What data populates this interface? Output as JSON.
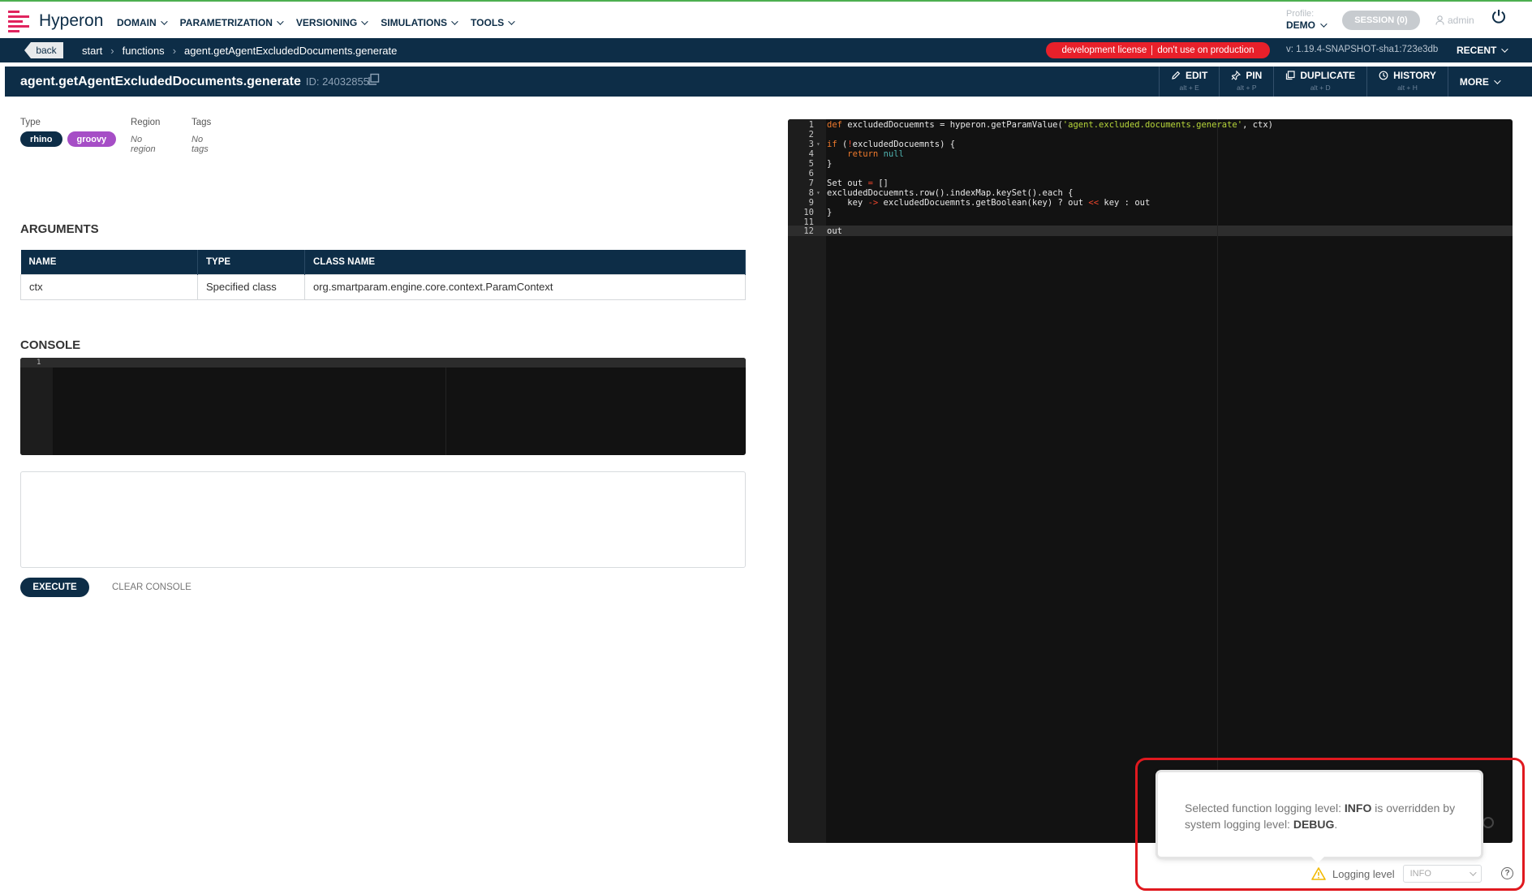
{
  "app": {
    "name": "Hyperon",
    "accent": "#e0245e",
    "navy": "#0d2d47"
  },
  "nav": [
    {
      "label": "DOMAIN"
    },
    {
      "label": "PARAMETRIZATION"
    },
    {
      "label": "VERSIONING"
    },
    {
      "label": "SIMULATIONS"
    },
    {
      "label": "TOOLS"
    }
  ],
  "profile": {
    "label": "Profile:",
    "value": "DEMO"
  },
  "session": {
    "label": "SESSION (0)"
  },
  "user": {
    "name": "admin"
  },
  "breadcrumb": {
    "back": "back",
    "items": [
      "start",
      "functions",
      "agent.getAgentExcludedDocuments.generate"
    ]
  },
  "license": {
    "part1": "development license",
    "part2": "don't use on production"
  },
  "version": "v: 1.19.4-SNAPSHOT-sha1:723e3db",
  "recent": "RECENT",
  "function": {
    "title": "agent.getAgentExcludedDocuments.generate",
    "id": "ID: 24032855"
  },
  "actions": [
    {
      "label": "EDIT",
      "kbd": "alt + E",
      "icon": "pencil-icon"
    },
    {
      "label": "PIN",
      "kbd": "alt + P",
      "icon": "pin-icon"
    },
    {
      "label": "DUPLICATE",
      "kbd": "alt + D",
      "icon": "copy-icon"
    },
    {
      "label": "HISTORY",
      "kbd": "alt + H",
      "icon": "clock-icon"
    }
  ],
  "more": "MORE",
  "meta": {
    "type_label": "Type",
    "types": [
      "rhino",
      "groovy"
    ],
    "region_label": "Region",
    "region_value": "No region",
    "tags_label": "Tags",
    "tags_value": "No tags"
  },
  "arguments": {
    "heading": "ARGUMENTS",
    "columns": [
      "NAME",
      "TYPE",
      "CLASS NAME"
    ],
    "rows": [
      [
        "ctx",
        "Specified class",
        "org.smartparam.engine.core.context.ParamContext"
      ]
    ]
  },
  "console": {
    "heading": "CONSOLE",
    "line": "1",
    "execute": "EXECUTE",
    "clear": "CLEAR CONSOLE"
  },
  "code": {
    "line_numbers": [
      "1",
      "2",
      "3",
      "4",
      "5",
      "6",
      "7",
      "8",
      "9",
      "10",
      "11",
      "12"
    ]
  },
  "tooltip": {
    "pre": "Selected function logging level: ",
    "level": "INFO",
    "mid": " is overridden by system logging level: ",
    "system_level": "DEBUG",
    "post": "."
  },
  "logging": {
    "label": "Logging level",
    "value": "INFO"
  }
}
